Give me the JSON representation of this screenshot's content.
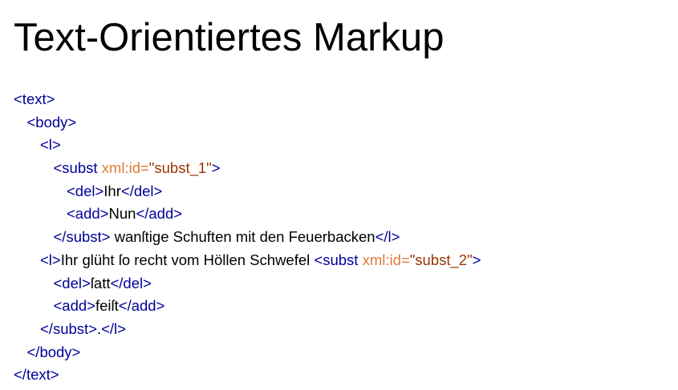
{
  "slide": {
    "title": "Text-Orientiertes Markup"
  },
  "colors": {
    "tag": "#000099",
    "attribute": "#E07B39",
    "attribute_value": "#993300",
    "text": "#000000"
  },
  "code_lines": [
    [
      {
        "t": "tag",
        "v": "<text>"
      }
    ],
    [
      {
        "t": "tag",
        "v": "<body>"
      }
    ],
    [
      {
        "t": "tag",
        "v": "<l>"
      }
    ],
    [
      {
        "t": "tag",
        "v": "<subst "
      },
      {
        "t": "attr",
        "v": "xml:id="
      },
      {
        "t": "val",
        "v": "\"subst_1\""
      },
      {
        "t": "tag",
        "v": ">"
      }
    ],
    [
      {
        "t": "tag",
        "v": "<del>"
      },
      {
        "t": "txt",
        "v": "Ihr"
      },
      {
        "t": "tag",
        "v": "</del>"
      }
    ],
    [
      {
        "t": "tag",
        "v": "<add>"
      },
      {
        "t": "txt",
        "v": "Nun"
      },
      {
        "t": "tag",
        "v": "</add>"
      }
    ],
    [
      {
        "t": "tag",
        "v": "</subst>"
      },
      {
        "t": "txt",
        "v": " wanſtige Schuften mit den Feuerbacken"
      },
      {
        "t": "tag",
        "v": "</l>"
      }
    ],
    [
      {
        "t": "tag",
        "v": "<l>"
      },
      {
        "t": "txt",
        "v": "Ihr glüht ſo recht vom Höllen Schwefel "
      },
      {
        "t": "tag",
        "v": "<subst "
      },
      {
        "t": "attr",
        "v": "xml:id="
      },
      {
        "t": "val",
        "v": "\"subst_2\""
      },
      {
        "t": "tag",
        "v": ">"
      }
    ],
    [
      {
        "t": "tag",
        "v": "<del>"
      },
      {
        "t": "txt",
        "v": "ſatt"
      },
      {
        "t": "tag",
        "v": "</del>"
      }
    ],
    [
      {
        "t": "tag",
        "v": "<add>"
      },
      {
        "t": "txt",
        "v": "feiſt"
      },
      {
        "t": "tag",
        "v": "</add>"
      }
    ],
    [
      {
        "t": "tag",
        "v": "</subst>"
      },
      {
        "t": "txt",
        "v": "."
      },
      {
        "t": "tag",
        "v": "</l>"
      }
    ],
    [
      {
        "t": "tag",
        "v": "</body>"
      }
    ],
    [
      {
        "t": "tag",
        "v": "</text>"
      }
    ]
  ]
}
